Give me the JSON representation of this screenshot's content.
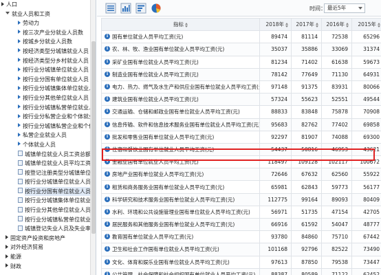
{
  "sidebar": {
    "items": [
      {
        "label": "人口",
        "level": 0,
        "icon": "right-triangle"
      },
      {
        "label": "就业人员和工资",
        "level": 1,
        "icon": "down-triangle"
      },
      {
        "label": "劳动力",
        "level": 2,
        "icon": "right-triangle"
      },
      {
        "label": "按三次产业分就业人员数",
        "level": 2,
        "icon": "right-triangle"
      },
      {
        "label": "按城乡分就业人员数",
        "level": 2,
        "icon": "right-triangle"
      },
      {
        "label": "按经济类型分城镇就业人员",
        "level": 2,
        "icon": "right-triangle"
      },
      {
        "label": "按经济类型分乡村就业人员",
        "level": 2,
        "icon": "right-triangle"
      },
      {
        "label": "按行业分城镇单位就业人员",
        "level": 2,
        "icon": "right-triangle"
      },
      {
        "label": "按行业分国有单位就业人员",
        "level": 2,
        "icon": "right-triangle"
      },
      {
        "label": "按行业分城镇集体单位就业人员",
        "level": 2,
        "icon": "right-triangle"
      },
      {
        "label": "按行业分其他单位就业人员",
        "level": 2,
        "icon": "right-triangle"
      },
      {
        "label": "按行业分城镇私营单位就业人员",
        "level": 2,
        "icon": "right-triangle"
      },
      {
        "label": "按行业分私营企业和个体就业人员",
        "level": 2,
        "icon": "right-triangle"
      },
      {
        "label": "按行业分城镇私营企业和个体就业",
        "level": 2,
        "icon": "right-triangle"
      },
      {
        "label": "私营企业就业人员",
        "level": 2,
        "icon": "right-triangle"
      },
      {
        "label": "个体就业人员",
        "level": 2,
        "icon": "right-triangle"
      },
      {
        "label": "城镇单位就业人员工资总额和指数",
        "level": 3,
        "icon": "checkbox"
      },
      {
        "label": "城镇单位就业人员平均工资和指数",
        "level": 3,
        "icon": "checkbox"
      },
      {
        "label": "按登记注册类型分城镇单位就业人员",
        "level": 3,
        "icon": "checkbox"
      },
      {
        "label": "按行业分城镇单位就业人员平均工资",
        "level": 3,
        "icon": "checkbox"
      },
      {
        "label": "按行业分国有单位就业人员平均工资",
        "level": 3,
        "icon": "checkbox",
        "selected": true
      },
      {
        "label": "按行业分城镇集体单位就业人员平均",
        "level": 3,
        "icon": "checkbox"
      },
      {
        "label": "按行业分其他单位就业人员平均工资",
        "level": 3,
        "icon": "checkbox"
      },
      {
        "label": "按行业分城镇私营单位就业人员平均",
        "level": 3,
        "icon": "checkbox"
      },
      {
        "label": "城镇登记失业人员及失业率",
        "level": 3,
        "icon": "checkbox"
      },
      {
        "label": "固定资产投资和房地产",
        "level": 1,
        "icon": "right-triangle"
      },
      {
        "label": "对外经济贸易",
        "level": 1,
        "icon": "right-triangle"
      },
      {
        "label": "能源",
        "level": 1,
        "icon": "right-triangle"
      },
      {
        "label": "财政",
        "level": 1,
        "icon": "right-triangle"
      }
    ]
  },
  "toolbar": {
    "time_label": "时间：",
    "time_value": "最近5年",
    "icons": [
      "table-icon",
      "bar-chart-icon",
      "horizontal-bar-chart-icon",
      "pie-chart-icon"
    ]
  },
  "table": {
    "headers": [
      "指标",
      "2018年",
      "2017年",
      "2016年",
      "2015年"
    ],
    "rows": [
      {
        "name": "国有单位就业人员平均工资(元)",
        "values": [
          "89474",
          "81114",
          "72538",
          "65296"
        ]
      },
      {
        "name": "农、林、牧、渔业国有单位就业人员平均工资(元)",
        "values": [
          "35037",
          "35886",
          "33069",
          "31374"
        ]
      },
      {
        "name": "采矿业国有单位就业人员平均工资(元)",
        "values": [
          "81234",
          "71402",
          "61638",
          "59673"
        ]
      },
      {
        "name": "制造业国有单位就业人员平均工资(元)",
        "values": [
          "78142",
          "77649",
          "71130",
          "64931"
        ]
      },
      {
        "name": "电力、热力、燃气及水生产和供应业国有单位就业人员平均工资(元)",
        "values": [
          "97148",
          "91375",
          "83931",
          "80066"
        ]
      },
      {
        "name": "建筑业国有单位就业人员平均工资(元)",
        "values": [
          "57324",
          "55623",
          "52551",
          "49544"
        ]
      },
      {
        "name": "交通运输、仓储和邮政业国有单位就业人员平均工资(元)",
        "values": [
          "88833",
          "83848",
          "75878",
          "70908"
        ]
      },
      {
        "name": "信息传输、软件和信息技术服务业国有单位就业人员平均工资(元)",
        "values": [
          "95683",
          "82762",
          "77402",
          "69858"
        ]
      },
      {
        "name": "批发和零售业国有单位就业人员平均工资(元)",
        "values": [
          "92297",
          "81907",
          "74088",
          "69300"
        ]
      },
      {
        "name": "住宿和餐饮业国有单位就业人员平均工资(元)",
        "values": [
          "54437",
          "50816",
          "46953",
          "43621"
        ]
      },
      {
        "name": "金融业国有单位就业人员平均工资(元)",
        "values": [
          "118497",
          "109128",
          "102117",
          "100672"
        ],
        "highlighted": true
      },
      {
        "name": "房地产业国有单位就业人员平均工资(元)",
        "values": [
          "72646",
          "67632",
          "62560",
          "55922"
        ]
      },
      {
        "name": "租赁和商务服务业国有单位就业人员平均工资(元)",
        "values": [
          "65981",
          "62843",
          "59773",
          "56177"
        ]
      },
      {
        "name": "科学研究和技术服务业国有单位就业人员平均工资(元)",
        "values": [
          "112775",
          "99164",
          "89093",
          "80409"
        ]
      },
      {
        "name": "水利、环境和公共设施管理业国有单位就业人员平均工资(元)",
        "values": [
          "56971",
          "51735",
          "47154",
          "42705"
        ]
      },
      {
        "name": "居民服务和其他服务业国有单位就业人员平均工资(元)",
        "values": [
          "66916",
          "61592",
          "54047",
          "48777"
        ]
      },
      {
        "name": "教育国有单位就业人员平均工资(元)",
        "values": [
          "93780",
          "84860",
          "75710",
          "67442"
        ]
      },
      {
        "name": "卫生和社会工作国有单位就业人员平均工资(元)",
        "values": [
          "101168",
          "92796",
          "82522",
          "73490"
        ]
      },
      {
        "name": "文化、体育和娱乐业国有单位就业人员平均工资(元)",
        "values": [
          "97613",
          "87850",
          "79538",
          "73447"
        ]
      },
      {
        "name": "公共管理、社会保障和社会组织国有单位就业人员平均工资(元)",
        "values": [
          "88387",
          "80589",
          "71122",
          "62452"
        ]
      }
    ]
  },
  "colors": {
    "accent": "#2a6ebb",
    "highlight_border": "#e02020",
    "header_bg": "#f0f3f7"
  }
}
